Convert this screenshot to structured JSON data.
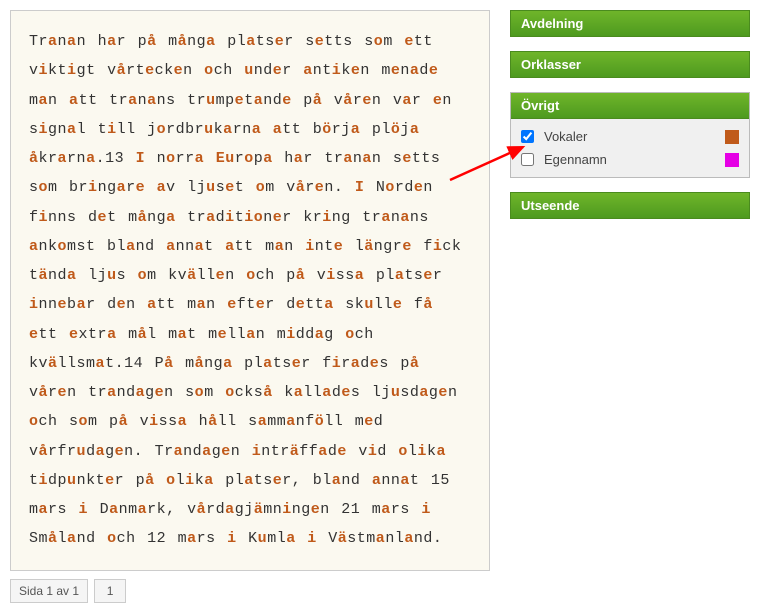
{
  "main_text": "Tranan har på många platser setts som ett viktigt vårtecken och under antiken menade man att tranans trumpetande på våren var en signal till jordbrukarna att börja plöja åkrarna.13 I norra Europa har tranan setts som bringare av ljuset om våren. I Norden finns det många traditioner kring tranans ankomst bland annat att man inte längre fick tända ljus om kvällen och på vissa platser innebar den att man efter detta skulle få ett extra mål mat mellan middag och kvällsmat.14 På många platser firades på våren trandagen som också kallades ljusdagen och som på vissa håll sammanföll med vårfrudagen. Trandagen inträffade vid olika tidpunkter på olika platser, bland annat 15 mars i Danmark, vårdagjämningen 21 mars i Småland och 12 mars i Kumla i Västmanland.",
  "pagination": {
    "info": "Sida 1 av 1",
    "page": "1"
  },
  "panels": {
    "avdelning": {
      "title": "Avdelning"
    },
    "orklasser": {
      "title": "Orklasser"
    },
    "ovrigt": {
      "title": "Övrigt",
      "options": [
        {
          "label": "Vokaler",
          "checked": true,
          "color": "#c05a1a"
        },
        {
          "label": "Egennamn",
          "checked": false,
          "color": "#e500e5"
        }
      ]
    },
    "utseende": {
      "title": "Utseende"
    }
  }
}
